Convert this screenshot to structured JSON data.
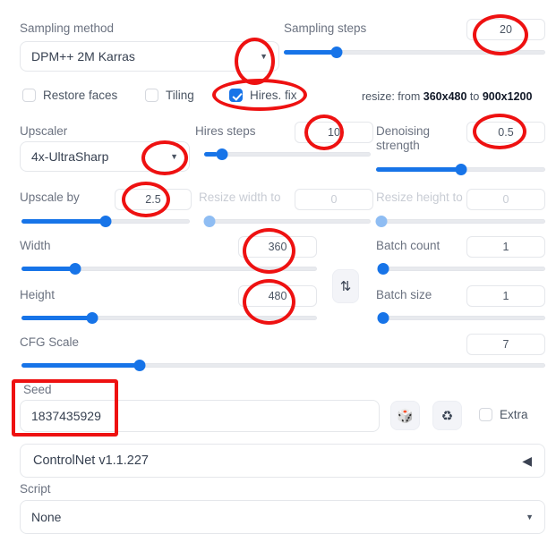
{
  "sampling": {
    "method_label": "Sampling method",
    "method_value": "DPM++ 2M Karras",
    "steps_label": "Sampling steps",
    "steps_value": "20",
    "steps_pct": 19
  },
  "toggles": {
    "restore_faces": "Restore faces",
    "tiling": "Tiling",
    "hires_fix": "Hires. fix",
    "restore_faces_checked": false,
    "tiling_checked": false,
    "hires_fix_checked": true
  },
  "resize_note": {
    "prefix": "resize: from ",
    "from": "360x480",
    "middle": " to ",
    "to": "900x1200"
  },
  "hires": {
    "upscaler_label": "Upscaler",
    "upscaler_value": "4x-UltraSharp",
    "hires_steps_label": "Hires steps",
    "hires_steps_value": "10",
    "hires_steps_pct": 8,
    "denoising_label_line1": "Denoising",
    "denoising_label_line2": "strength",
    "denoising_value": "0.5",
    "denoising_pct": 50,
    "upscale_by_label": "Upscale by",
    "upscale_by_value": "2.5",
    "upscale_by_pct": 50,
    "resize_width_label": "Resize width to",
    "resize_width_value": "0",
    "resize_width_pct": 0,
    "resize_height_label": "Resize height to",
    "resize_height_value": "0",
    "resize_height_pct": 0
  },
  "dimensions": {
    "width_label": "Width",
    "width_value": "360",
    "width_pct": 17,
    "height_label": "Height",
    "height_value": "480",
    "height_pct": 23,
    "swap_icon": "swap-vertical-icon",
    "swap_glyph": "⇅"
  },
  "batch": {
    "count_label": "Batch count",
    "count_value": "1",
    "count_pct": 0,
    "size_label": "Batch size",
    "size_value": "1",
    "size_pct": 0
  },
  "cfg": {
    "label": "CFG Scale",
    "value": "7",
    "pct": 22
  },
  "seed": {
    "label": "Seed",
    "value": "1837435929",
    "dice_glyph": "🎲",
    "recycle_glyph": "♻",
    "extra_label": "Extra",
    "extra_checked": false
  },
  "controlnet": {
    "title": "ControlNet v1.1.227",
    "collapse_glyph": "◀"
  },
  "script": {
    "label": "Script",
    "value": "None",
    "caret_glyph": "▾"
  },
  "colors": {
    "accent": "#1774e8",
    "annotation": "#ee1111",
    "label": "#6b7280",
    "disabled": "#c8ccd4"
  }
}
